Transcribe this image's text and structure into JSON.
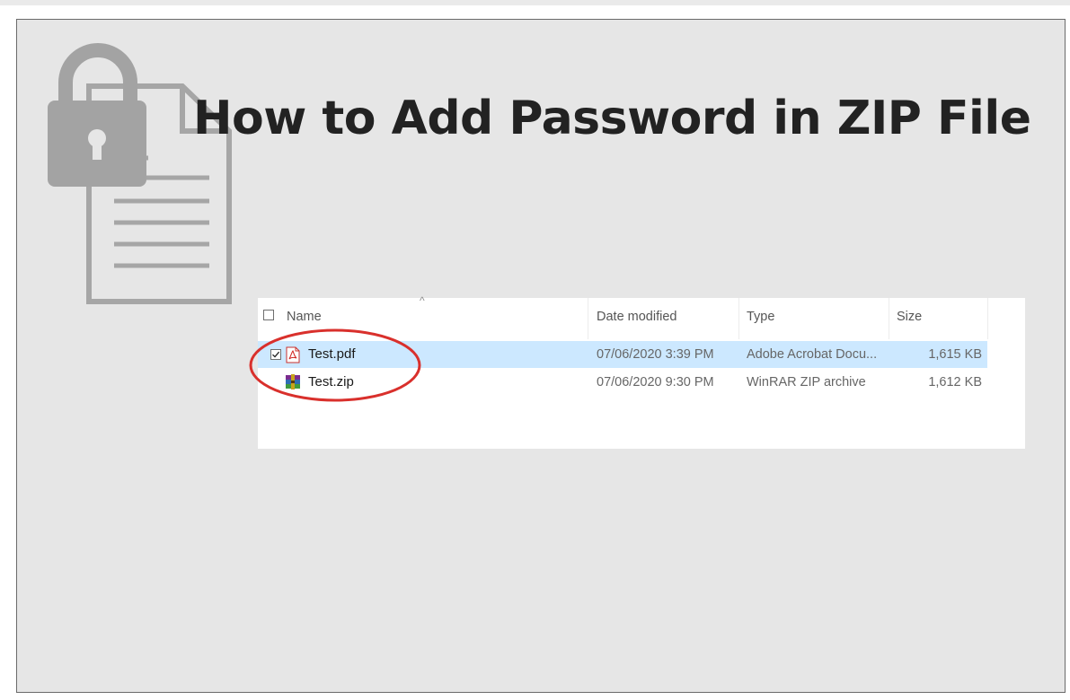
{
  "title": "How to Add Password in ZIP File",
  "explorer": {
    "columns": {
      "name": "Name",
      "date_modified": "Date modified",
      "type": "Type",
      "size": "Size"
    },
    "sort_indicator": "^",
    "files": [
      {
        "name": "Test.pdf",
        "date_modified": "07/06/2020 3:39 PM",
        "type": "Adobe Acrobat Docu...",
        "size": "1,615 KB",
        "icon": "pdf-file-icon",
        "selected": true,
        "checked": true
      },
      {
        "name": "Test.zip",
        "date_modified": "07/06/2020 9:30 PM",
        "type": "WinRAR ZIP archive",
        "size": "1,612 KB",
        "icon": "winrar-archive-icon",
        "selected": false,
        "checked": false
      }
    ]
  },
  "colors": {
    "slide_background": "#e6e6e6",
    "selection": "#cce8ff",
    "highlight_ellipse": "#d9302c",
    "illustration": "#a6a6a6"
  }
}
